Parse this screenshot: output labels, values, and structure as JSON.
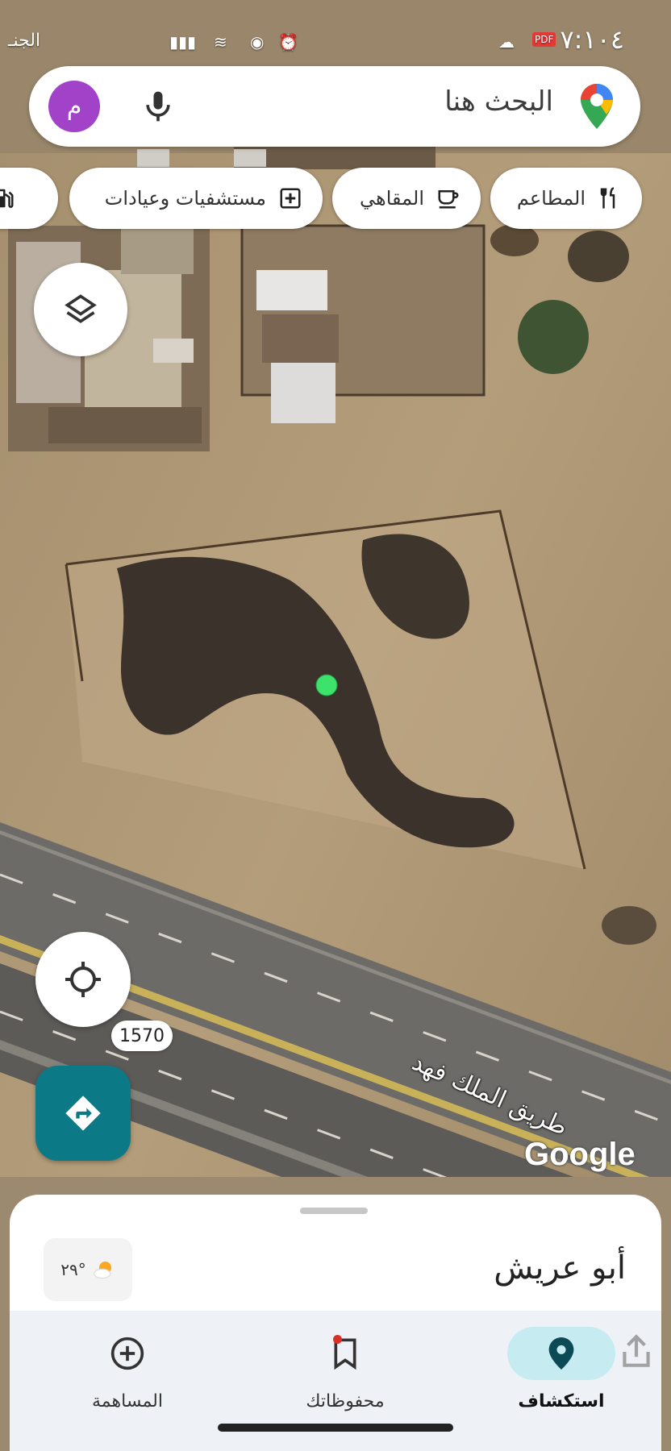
{
  "status_bar": {
    "time": "٧:١٠٤",
    "carrier": "الجنـ",
    "icons": [
      "cloud-icon",
      "pdf-icon",
      "wifi-icon",
      "location-icon",
      "alarm-icon",
      "signal-icon"
    ]
  },
  "search": {
    "placeholder": "البحث هنا",
    "avatar_letter": "م",
    "avatar_color": "#a142c9"
  },
  "chips": [
    {
      "label": "المطاعم",
      "icon": "restaurant-icon"
    },
    {
      "label": "المقاهي",
      "icon": "coffee-icon"
    },
    {
      "label": "مستشفيات وعيادات",
      "icon": "hospital-icon"
    },
    {
      "label": "",
      "icon": "gas-station-icon"
    }
  ],
  "map": {
    "road_label": "طريق الملك فهد",
    "scale_value": "1570",
    "watermark": "Google",
    "location_dot_color": "#3de26a"
  },
  "sheet": {
    "place_name": "أبو عريش",
    "weather_temp": "٢٩°",
    "weather_icon": "partly-cloudy-icon"
  },
  "bottom_nav": [
    {
      "label": "استكشاف",
      "icon": "explore-pin-icon",
      "active": true
    },
    {
      "label": "محفوظاتك",
      "icon": "bookmark-icon",
      "active": false
    },
    {
      "label": "المساهمة",
      "icon": "add-circle-icon",
      "active": false
    }
  ],
  "colors": {
    "accent_teal": "#0c7a86",
    "active_nav_bg": "#c6ecf2"
  }
}
